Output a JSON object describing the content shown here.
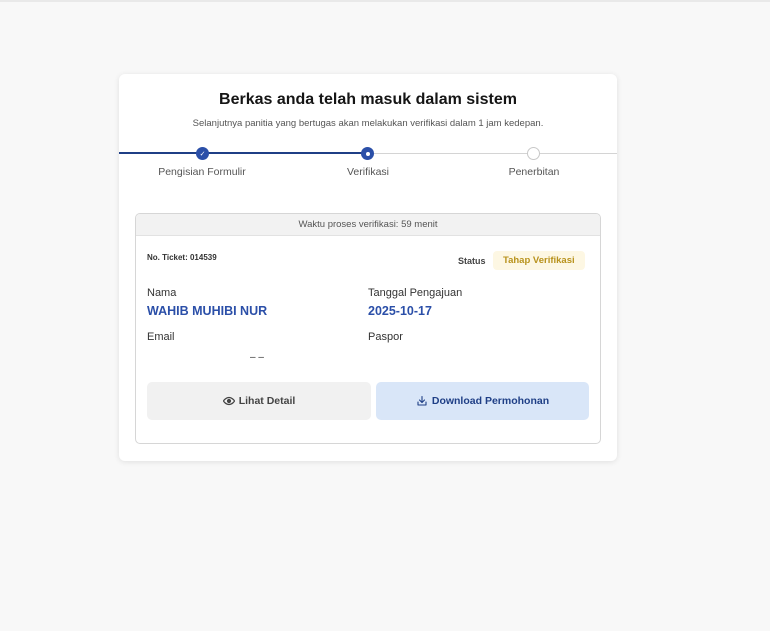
{
  "header": {
    "title": "Berkas anda telah masuk dalam sistem",
    "subtitle": "Selanjutnya panitia yang bertugas akan melakukan verifikasi dalam 1 jam kedepan."
  },
  "stepper": {
    "steps": [
      {
        "label": "Pengisian Formulir",
        "state": "done"
      },
      {
        "label": "Verifikasi",
        "state": "active"
      },
      {
        "label": "Penerbitan",
        "state": "pending"
      }
    ]
  },
  "panel": {
    "process_time": "Waktu proses verifikasi: 59 menit",
    "ticket": "No. Ticket: 014539",
    "status_label": "Status",
    "status_value": "Tahap Verifikasi",
    "fields": {
      "nama_label": "Nama",
      "nama_value": "WAHIB MUHIBI NUR",
      "tanggal_label": "Tanggal Pengajuan",
      "tanggal_value": "2025-10-17",
      "email_label": "Email",
      "email_value": "– –",
      "paspor_label": "Paspor"
    },
    "buttons": {
      "detail": "Lihat Detail",
      "download": "Download Permohonan"
    }
  },
  "colors": {
    "primary": "#2b4fa8",
    "primary_dark": "#1f3f86",
    "badge_bg": "#fdf7e3",
    "badge_text": "#b8921c"
  }
}
